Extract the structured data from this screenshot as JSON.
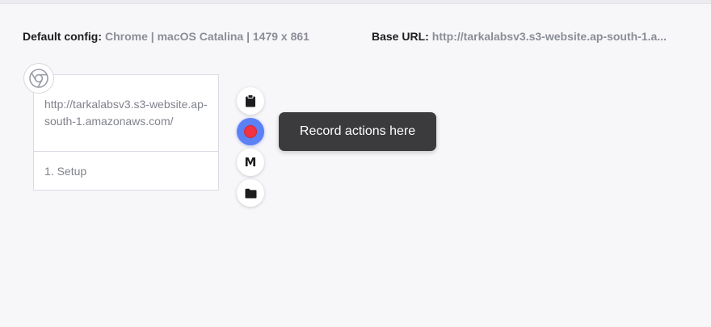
{
  "config": {
    "default_label": "Default config:",
    "default_value": "Chrome | macOS Catalina | 1479 x 861",
    "base_url_label": "Base URL:",
    "base_url_value": "http://tarkalabsv3.s3-website.ap-south-1.a..."
  },
  "browser_icon": "chrome-icon",
  "step_card": {
    "url": "http://tarkalabsv3.s3-website.ap-south-1.amazonaws.com/",
    "step": "1. Setup"
  },
  "actions": [
    {
      "name": "clipboard",
      "icon": "clipboard-icon"
    },
    {
      "name": "record",
      "icon": "record-icon",
      "color": "#f03243",
      "bg": "#5c80f5"
    },
    {
      "name": "m",
      "icon": "m-logo-icon",
      "glyph": "M"
    },
    {
      "name": "folder",
      "icon": "folder-icon"
    }
  ],
  "tooltip": {
    "text": "Record actions here"
  }
}
